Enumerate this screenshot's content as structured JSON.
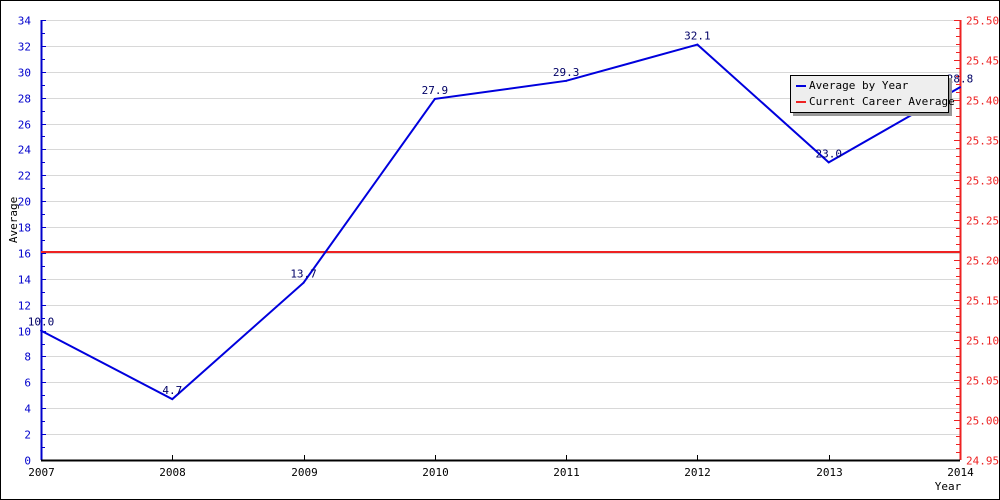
{
  "chart_data": {
    "type": "line",
    "title": "",
    "xlabel": "Year",
    "ylabel": "Average",
    "x": [
      "2007",
      "2008",
      "2009",
      "2010",
      "2011",
      "2012",
      "2013",
      "2014"
    ],
    "series": [
      {
        "name": "Average by Year",
        "axis": "left",
        "color": "#0000dd",
        "values": [
          10.0,
          4.7,
          13.7,
          27.9,
          29.3,
          32.1,
          23.0,
          28.8
        ],
        "labels": [
          "10.0",
          "4.7",
          "13.7",
          "27.9",
          "29.3",
          "32.1",
          "23.0",
          "28.8"
        ]
      },
      {
        "name": "Current Career Average",
        "axis": "right",
        "color": "#ee2222",
        "value": 25.21
      }
    ],
    "ylim": [
      0,
      34
    ],
    "yticks": [
      "0",
      "2",
      "4",
      "6",
      "8",
      "10",
      "12",
      "14",
      "16",
      "18",
      "20",
      "22",
      "24",
      "26",
      "28",
      "30",
      "32",
      "34"
    ],
    "y2lim": [
      24.95,
      25.5
    ],
    "y2ticks": [
      "24.95",
      "25.00",
      "25.05",
      "25.10",
      "25.15",
      "25.20",
      "25.25",
      "25.30",
      "25.35",
      "25.40",
      "25.45",
      "25.50"
    ],
    "grid": true,
    "legend_position": "top-right"
  }
}
